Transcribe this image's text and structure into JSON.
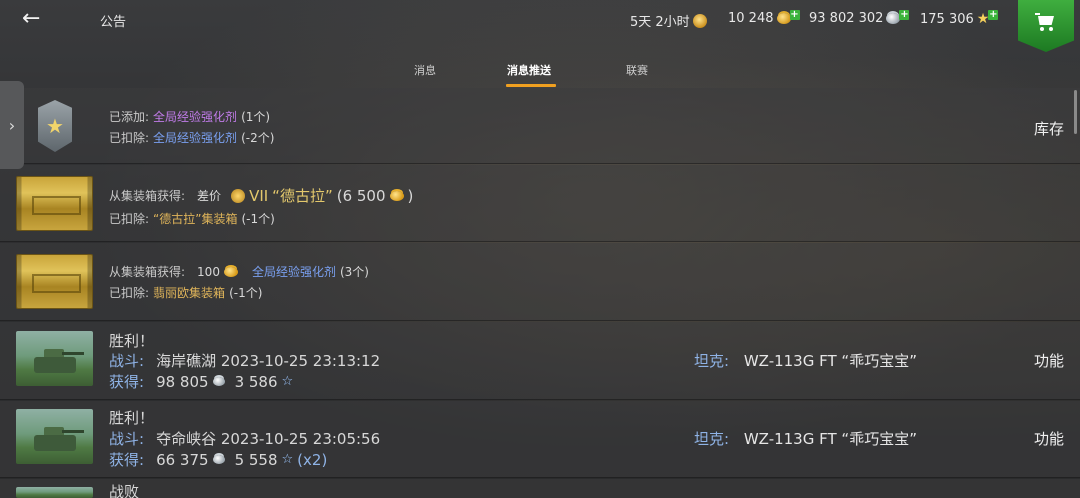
{
  "header": {
    "title": "公告",
    "premium_time": "5天 2小时",
    "gold": "10 248",
    "credits": "93 802 302",
    "free_xp": "175 306"
  },
  "tabs": [
    {
      "label": "消息"
    },
    {
      "label": "消息推送"
    },
    {
      "label": "联赛"
    }
  ],
  "messages": [
    {
      "line1_prefix": "已添加:",
      "line1_item": "全局经验强化剂",
      "line1_count": "(1个)",
      "line2_prefix": "已扣除:",
      "line2_item": "全局经验强化剂",
      "line2_count": "(-2个)",
      "action": "库存"
    },
    {
      "line1_prefix": "从集装箱获得:",
      "line1_diff": "差价",
      "line1_tier": "VII",
      "line1_tank": "“德古拉”",
      "line1_amount": "(6 500",
      "line1_close": ")",
      "line2_prefix": "已扣除:",
      "line2_item": "“德古拉”集装箱",
      "line2_count": "(-1个)"
    },
    {
      "line1_prefix": "从集装箱获得:",
      "line1_gold": "100",
      "line1_item": "全局经验强化剂",
      "line1_count": "(3个)",
      "line2_prefix": "已扣除:",
      "line2_item": "翡丽欧集装箱",
      "line2_count": "(-1个)"
    },
    {
      "result": "胜利！",
      "battle_label": "战斗:",
      "battle_value": "海岸礁湖 2023-10-25 23:13:12",
      "earned_label": "获得:",
      "credits": "98 805",
      "xp": "3 586",
      "tank_label": "坦克:",
      "tank_value": "WZ-113G FT “乖巧宝宝”",
      "action": "功能"
    },
    {
      "result": "胜利！",
      "battle_label": "战斗:",
      "battle_value": "夺命峡谷 2023-10-25 23:05:56",
      "earned_label": "获得:",
      "credits": "66 375",
      "xp": "5 558",
      "xp_mult": "(x2)",
      "tank_label": "坦克:",
      "tank_value": "WZ-113G FT “乖巧宝宝”",
      "action": "功能"
    },
    {
      "result": "战败"
    }
  ]
}
